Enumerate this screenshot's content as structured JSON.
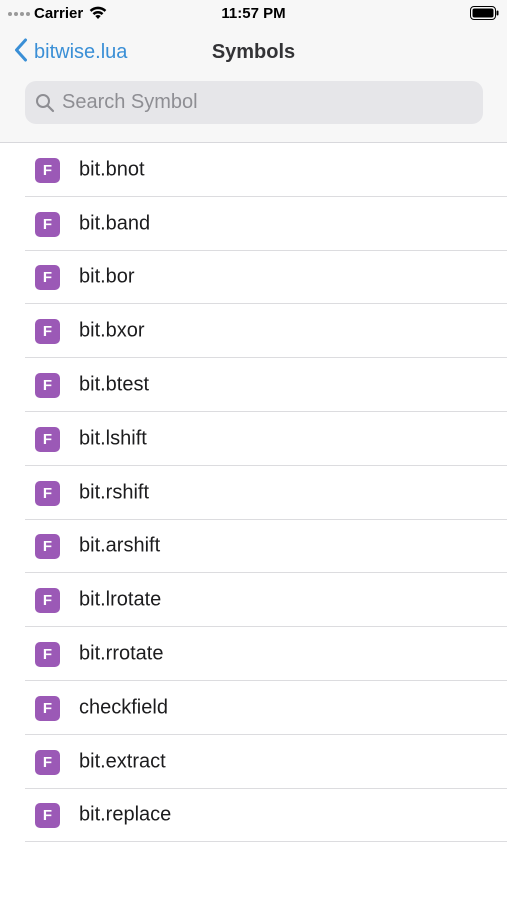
{
  "status_bar": {
    "carrier": "Carrier",
    "time": "11:57 PM"
  },
  "nav": {
    "back_label": "bitwise.lua",
    "title": "Symbols"
  },
  "search": {
    "placeholder": "Search Symbol",
    "value": ""
  },
  "colors": {
    "accent": "#3a8fd6",
    "function_badge": "#9b59b6"
  },
  "symbols": [
    {
      "kind": "F",
      "name": "bit.bnot"
    },
    {
      "kind": "F",
      "name": "bit.band"
    },
    {
      "kind": "F",
      "name": "bit.bor"
    },
    {
      "kind": "F",
      "name": "bit.bxor"
    },
    {
      "kind": "F",
      "name": "bit.btest"
    },
    {
      "kind": "F",
      "name": "bit.lshift"
    },
    {
      "kind": "F",
      "name": "bit.rshift"
    },
    {
      "kind": "F",
      "name": "bit.arshift"
    },
    {
      "kind": "F",
      "name": "bit.lrotate"
    },
    {
      "kind": "F",
      "name": "bit.rrotate"
    },
    {
      "kind": "F",
      "name": "checkfield"
    },
    {
      "kind": "F",
      "name": "bit.extract"
    },
    {
      "kind": "F",
      "name": "bit.replace"
    }
  ]
}
